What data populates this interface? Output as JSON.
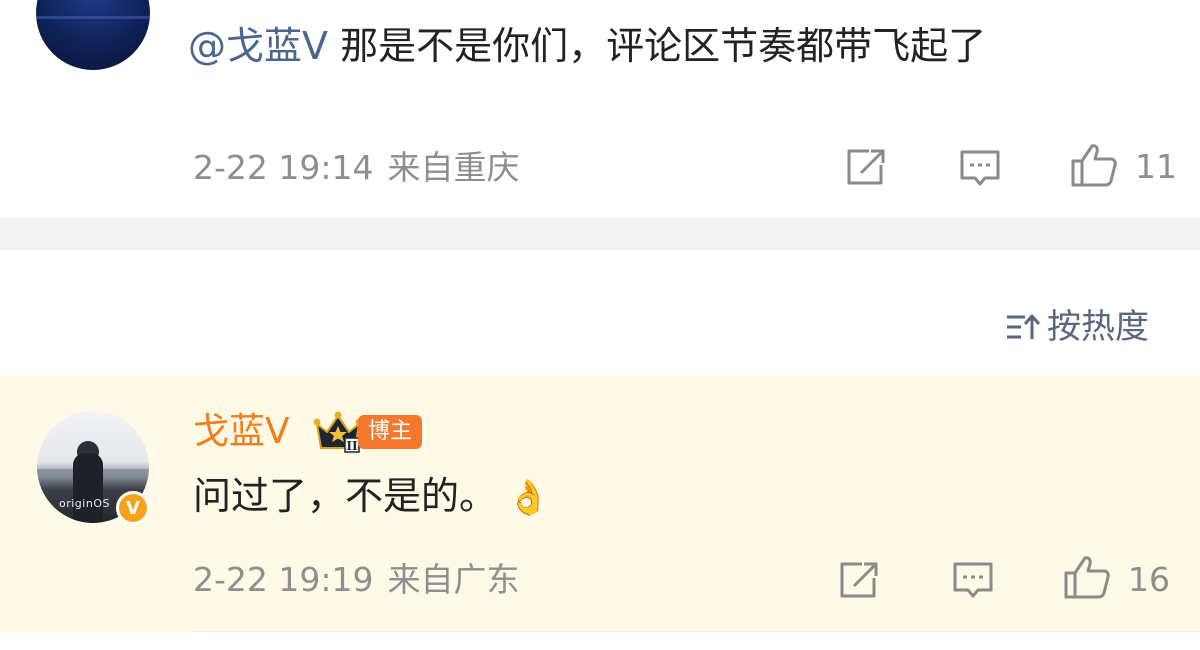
{
  "comments": [
    {
      "mention": "@戈蓝V",
      "text": " 那是不是你们，评论区节奏都带飞起了",
      "time": "2-22 19:14",
      "location": "来自重庆",
      "likes": "11"
    }
  ],
  "sort": {
    "icon": "sort-icon",
    "label": "按热度"
  },
  "pinned_comment": {
    "author": "戈蓝V",
    "rank_badge": "II",
    "role_badge": "博主",
    "verified_badge": "V",
    "text": "问过了，不是的。",
    "emoji": "👌",
    "time": "2-22 19:19",
    "location": "来自广东",
    "likes": "16",
    "avatar_brand": "originOS"
  },
  "icons": {
    "share": "share-icon",
    "comment": "comment-icon",
    "like": "thumbs-up-icon"
  },
  "colors": {
    "name_orange": "#f07e1c",
    "mention_blue": "#4a6590",
    "highlight_bg": "#fff9e6",
    "badge_orange": "#f5782d",
    "meta_gray": "#8e8e8e"
  }
}
